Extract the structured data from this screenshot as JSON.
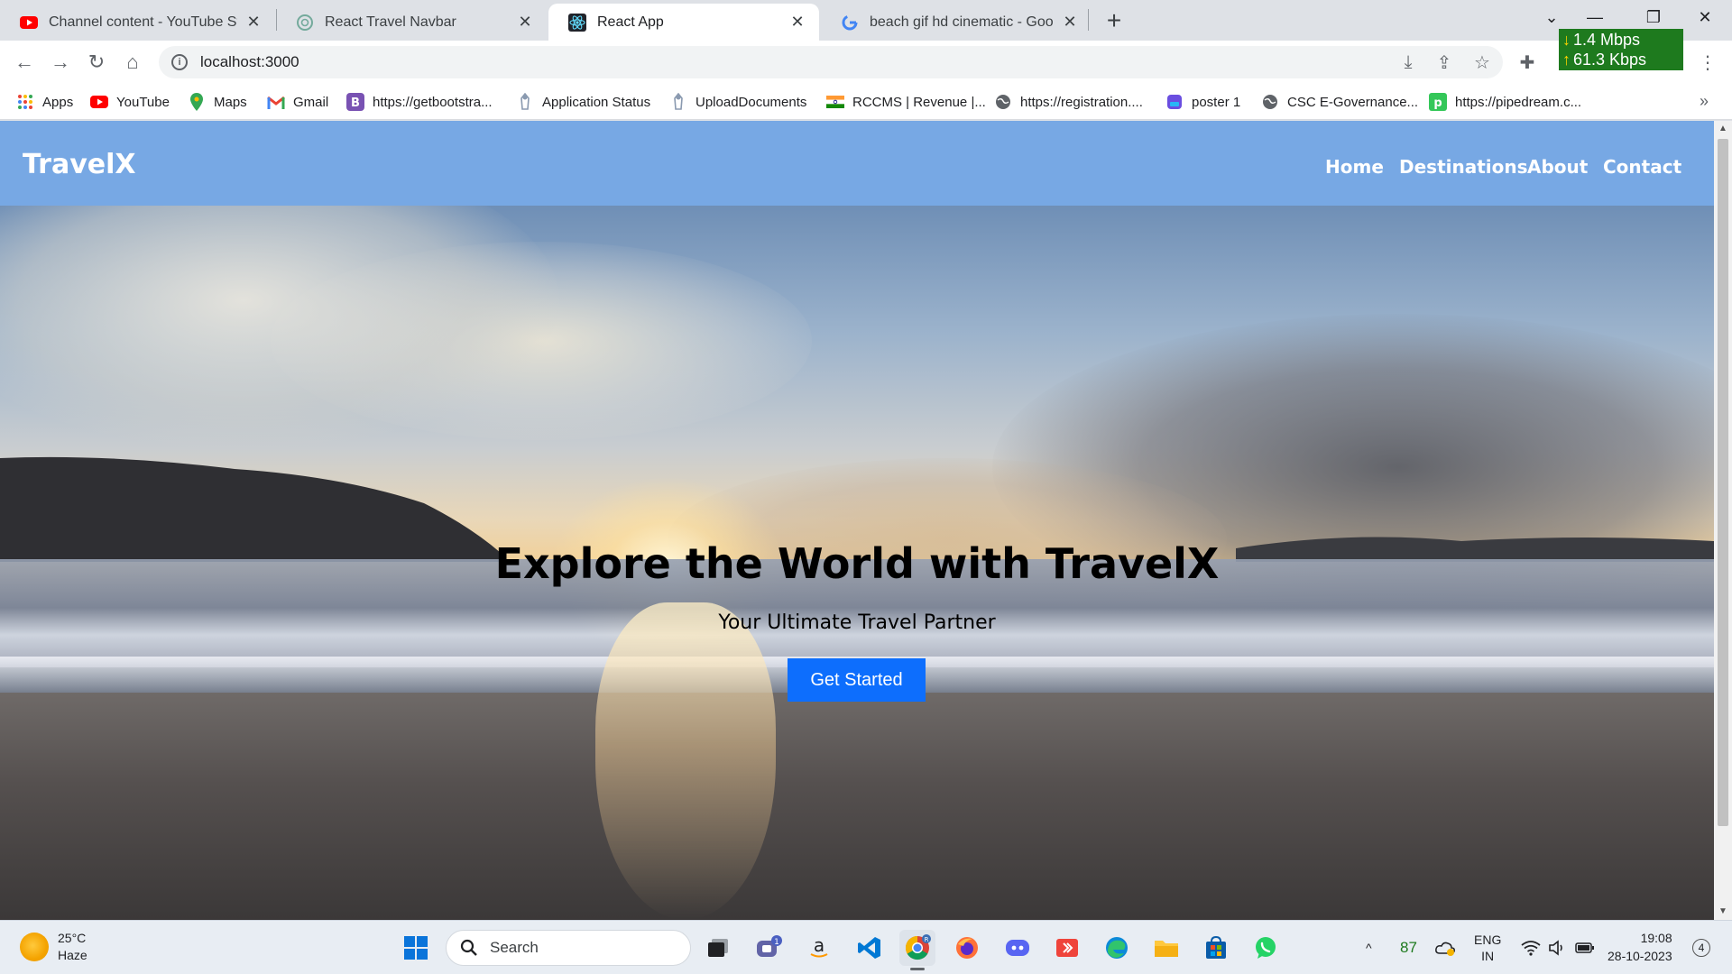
{
  "browser": {
    "tabs": [
      {
        "title": "Channel content - YouTube Stud",
        "icon": "youtube-icon"
      },
      {
        "title": "React Travel Navbar",
        "icon": "chatgpt-icon"
      },
      {
        "title": "React App",
        "icon": "react-icon"
      },
      {
        "title": "beach gif hd cinematic - Google",
        "icon": "google-icon"
      }
    ],
    "address": "localhost:3000",
    "network": {
      "download": "1.4 Mbps",
      "upload": "61.3 Kbps"
    },
    "bookmarks": [
      {
        "label": "Apps",
        "icon": "apps-grid-icon"
      },
      {
        "label": "YouTube",
        "icon": "youtube-icon"
      },
      {
        "label": "Maps",
        "icon": "maps-pin-icon"
      },
      {
        "label": "Gmail",
        "icon": "gmail-icon"
      },
      {
        "label": "https://getbootstra...",
        "icon": "bootstrap-icon"
      },
      {
        "label": "Application Status",
        "icon": "emblem-icon"
      },
      {
        "label": "UploadDocuments",
        "icon": "emblem-icon"
      },
      {
        "label": "RCCMS | Revenue |...",
        "icon": "india-flag-icon"
      },
      {
        "label": "https://registration....",
        "icon": "globe-icon"
      },
      {
        "label": "poster 1",
        "icon": "poster-icon"
      },
      {
        "label": "CSC E-Governance...",
        "icon": "globe-icon"
      },
      {
        "label": "https://pipedream.c...",
        "icon": "pipedream-icon"
      }
    ]
  },
  "site": {
    "brand": "TravelX",
    "nav": [
      "Home",
      "Destinations",
      "About",
      "Contact"
    ],
    "hero": {
      "title": "Explore the World with TravelX",
      "subtitle": "Your Ultimate Travel Partner",
      "cta": "Get Started"
    },
    "colors": {
      "navbar": "#77a8e4",
      "cta": "#0d6efd"
    }
  },
  "taskbar": {
    "weather": {
      "temp": "25°C",
      "condition": "Haze"
    },
    "search_placeholder": "Search",
    "teams_badge": "1",
    "chrome_badge": "R",
    "tray": {
      "battery": "87",
      "lang": "ENG",
      "region": "IN"
    },
    "time": "19:08",
    "date": "28-10-2023",
    "notifications": "4"
  }
}
